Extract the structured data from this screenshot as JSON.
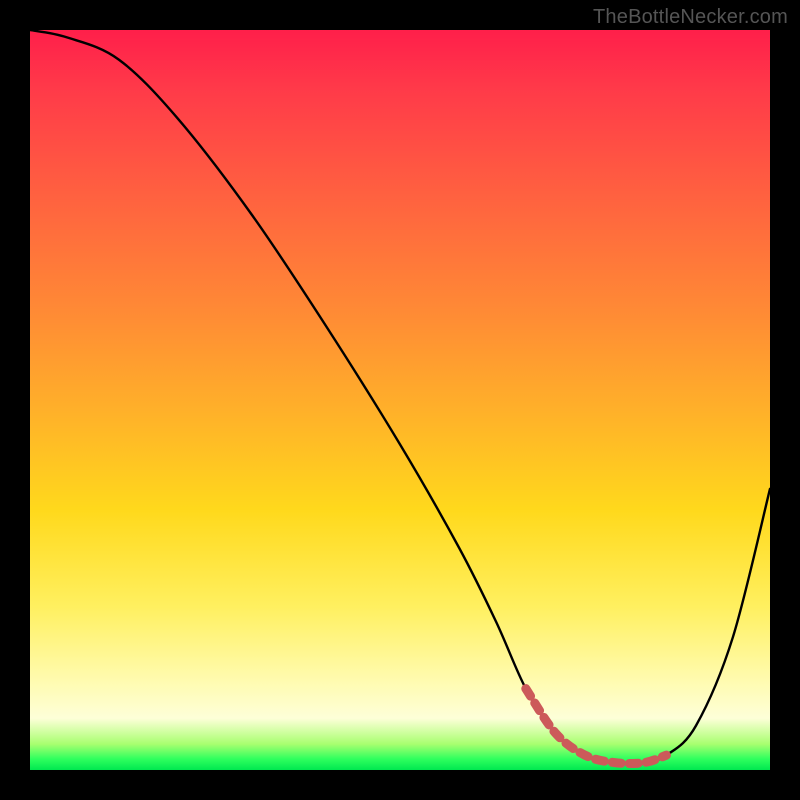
{
  "watermark": "TheBottleNecker.com",
  "colors": {
    "background": "#000000",
    "curve": "#000000",
    "highlight": "#cc5a5a",
    "gradient_top": "#ff1f4a",
    "gradient_bottom": "#00e850"
  },
  "chart_data": {
    "type": "line",
    "title": "",
    "xlabel": "",
    "ylabel": "",
    "xlim": [
      0,
      100
    ],
    "ylim": [
      0,
      100
    ],
    "series": [
      {
        "name": "bottleneck-curve",
        "x": [
          0,
          5,
          12,
          20,
          30,
          40,
          50,
          58,
          63,
          67,
          71,
          75,
          79,
          83,
          86,
          90,
          95,
          100
        ],
        "values": [
          100,
          99,
          96,
          88,
          75,
          60,
          44,
          30,
          20,
          11,
          5,
          2,
          1,
          1,
          2,
          6,
          18,
          38
        ]
      }
    ],
    "highlight_segment": {
      "x_start": 65,
      "x_end": 86
    },
    "grid": false,
    "legend": false
  }
}
